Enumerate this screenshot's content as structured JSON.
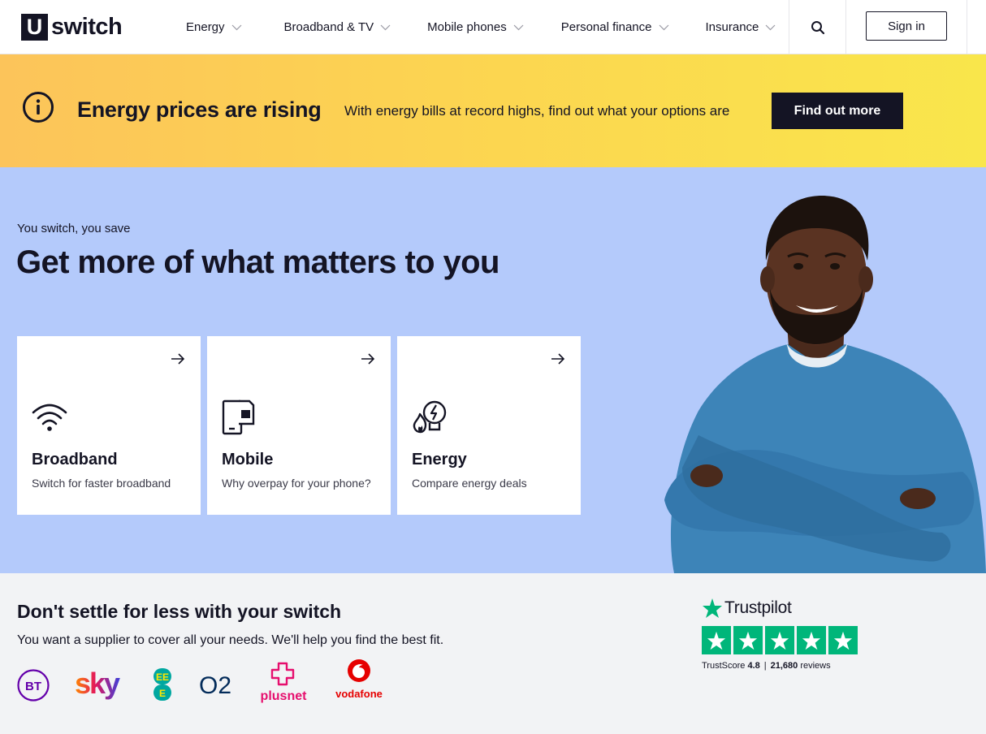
{
  "header": {
    "logo_mark": "U",
    "logo_text": "switch",
    "nav": [
      {
        "label": "Energy"
      },
      {
        "label": "Broadband & TV"
      },
      {
        "label": "Mobile phones"
      },
      {
        "label": "Personal finance"
      },
      {
        "label": "Insurance"
      }
    ],
    "search_icon": "search-icon",
    "signin_label": "Sign in"
  },
  "banner": {
    "icon": "info-icon",
    "title": "Energy prices are rising",
    "text": "With energy bills at record highs, find out what your options are",
    "button_label": "Find out more",
    "colors": {
      "from": "#fcc45a",
      "to": "#f9e64b"
    }
  },
  "hero": {
    "eyebrow": "You switch, you save",
    "title": "Get more of what matters to you",
    "background": "#b4cafb",
    "cards": [
      {
        "icon": "wifi-icon",
        "title": "Broadband",
        "subtitle": "Switch for faster broadband"
      },
      {
        "icon": "mobile-sim-icon",
        "title": "Mobile",
        "subtitle": "Why overpay for your phone?"
      },
      {
        "icon": "energy-bulb-flame-icon",
        "title": "Energy",
        "subtitle": "Compare energy deals"
      }
    ]
  },
  "bottom": {
    "title": "Don't settle for less with your switch",
    "subtitle": "You want a supplier to cover all your needs. We'll help you find the best fit.",
    "brands": [
      {
        "name": "BT",
        "text": "BT",
        "color": "#6400aa"
      },
      {
        "name": "Sky",
        "text": "sky",
        "color": "#e3165b"
      },
      {
        "name": "EE",
        "text": "EE",
        "color": "#00a7a0"
      },
      {
        "name": "O2",
        "text": "O2",
        "color": "#032b5a"
      },
      {
        "name": "Plusnet",
        "text": "plusnet",
        "color": "#e60f6e"
      },
      {
        "name": "Vodafone",
        "text": "vodafone",
        "color": "#e60000"
      }
    ]
  },
  "trustpilot": {
    "name": "Trustpilot",
    "score_label": "TrustScore",
    "score": "4.8",
    "reviews_count": "21,680",
    "reviews_label": "reviews",
    "rating_stars": 5,
    "color": "#00b67a"
  }
}
